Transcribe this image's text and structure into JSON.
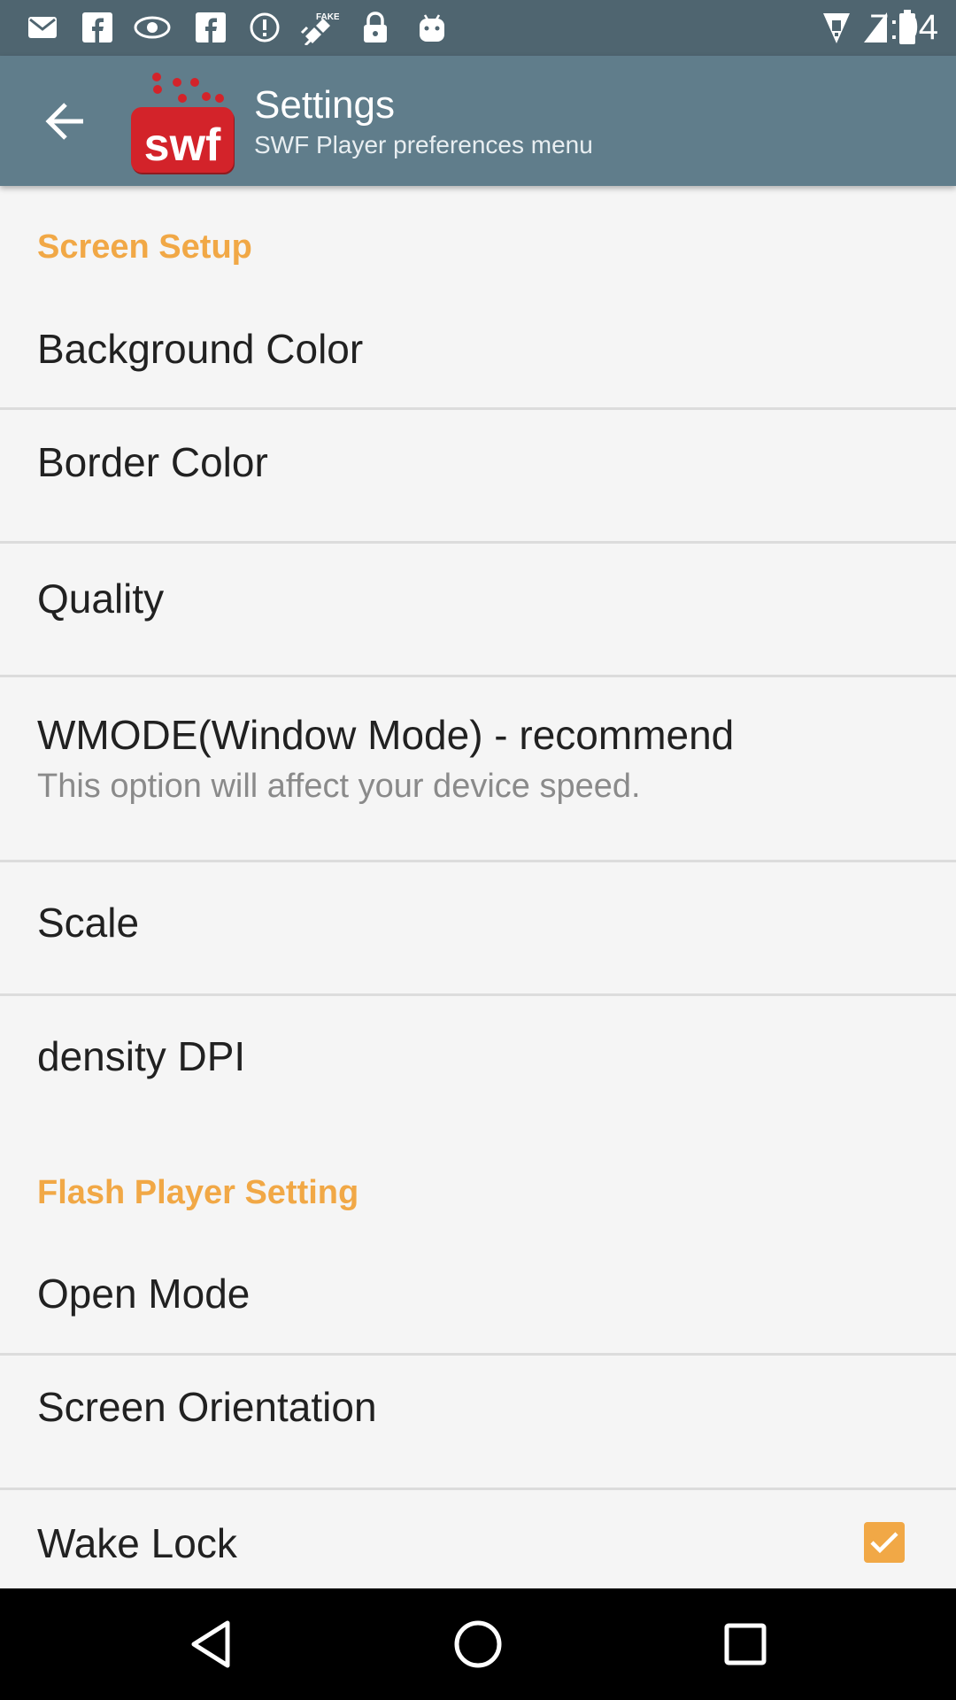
{
  "status_bar": {
    "time": "7:04",
    "left_icons": [
      "email-icon",
      "facebook-icon",
      "eye-icon",
      "facebook-icon",
      "alert-icon",
      "satellite-icon",
      "lock-icon",
      "android-icon"
    ],
    "right_icons": [
      "wifi-icon",
      "signal-icon",
      "battery-icon"
    ],
    "color": "#4f6570"
  },
  "app_bar": {
    "title": "Settings",
    "subtitle": "SWF Player preferences menu",
    "logo_text": "swf",
    "color": "#607d8b"
  },
  "colors": {
    "accent": "#f1a846",
    "logo_red": "#d3232a",
    "background": "#f5f5f5"
  },
  "sections": [
    {
      "title": "Screen Setup",
      "items": [
        {
          "title": "Background Color"
        },
        {
          "title": "Border Color"
        },
        {
          "title": "Quality"
        },
        {
          "title": "WMODE(Window Mode) - recommend",
          "summary": "This option will affect your device speed."
        },
        {
          "title": "Scale"
        },
        {
          "title": "density DPI"
        }
      ]
    },
    {
      "title": "Flash Player Setting",
      "items": [
        {
          "title": "Open Mode"
        },
        {
          "title": "Screen Orientation"
        },
        {
          "title": "Wake Lock",
          "checked": true
        }
      ]
    }
  ],
  "nav_bar": {
    "buttons": [
      "back-triangle-icon",
      "home-circle-icon",
      "recents-square-icon"
    ]
  }
}
